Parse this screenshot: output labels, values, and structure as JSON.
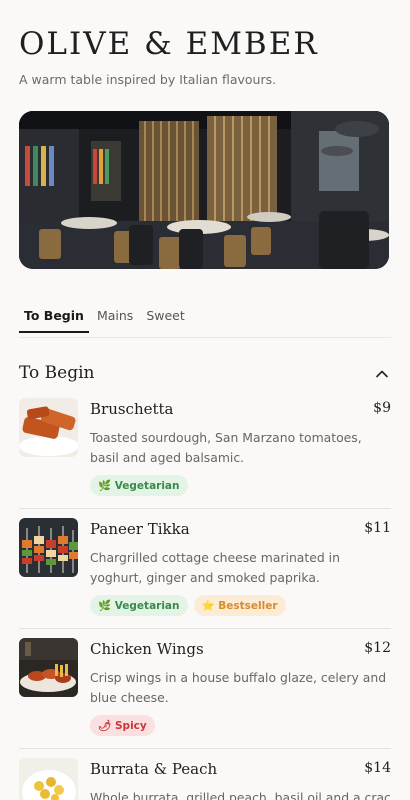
{
  "brand": {
    "name": "OLIVE & EMBER",
    "tagline": "A warm table inspired by Italian flavours."
  },
  "hero": {
    "image": "restaurant-interior"
  },
  "tabs": [
    {
      "label": "To Begin",
      "active": true
    },
    {
      "label": "Mains",
      "active": false
    },
    {
      "label": "Sweet",
      "active": false
    }
  ],
  "section": {
    "title": "To Begin",
    "toggle_icon": "chevron-up-icon"
  },
  "items": [
    {
      "name": "Bruschetta",
      "price": "$9",
      "description": "Toasted sourdough, San Marzano tomatoes, basil and aged balsamic.",
      "badges": [
        {
          "icon": "leaf-icon",
          "glyph": "🌿",
          "label": "Vegetarian"
        }
      ]
    },
    {
      "name": "Paneer Tikka",
      "price": "$11",
      "description": "Chargrilled cottage cheese marinated in yoghurt, ginger and smoked paprika.",
      "badges": [
        {
          "icon": "leaf-icon",
          "glyph": "🌿",
          "label": "Vegetarian"
        },
        {
          "icon": "star-icon",
          "glyph": "⭐",
          "label": "Bestseller"
        }
      ]
    },
    {
      "name": "Chicken Wings",
      "price": "$12",
      "description": "Crisp wings in a house buffalo glaze, celery and blue cheese.",
      "badges": [
        {
          "icon": "chili-icon",
          "glyph": "🌶",
          "label": "Spicy"
        }
      ]
    },
    {
      "name": "Burrata & Peach",
      "price": "$14",
      "description": "Whole burrata, grilled peach, basil oil and a crack",
      "badges": []
    }
  ],
  "colors": {
    "veg": "#3a8a4c",
    "bestseller": "#d98a2c",
    "spicy": "#c9363b",
    "text": "#1f1f1f"
  }
}
